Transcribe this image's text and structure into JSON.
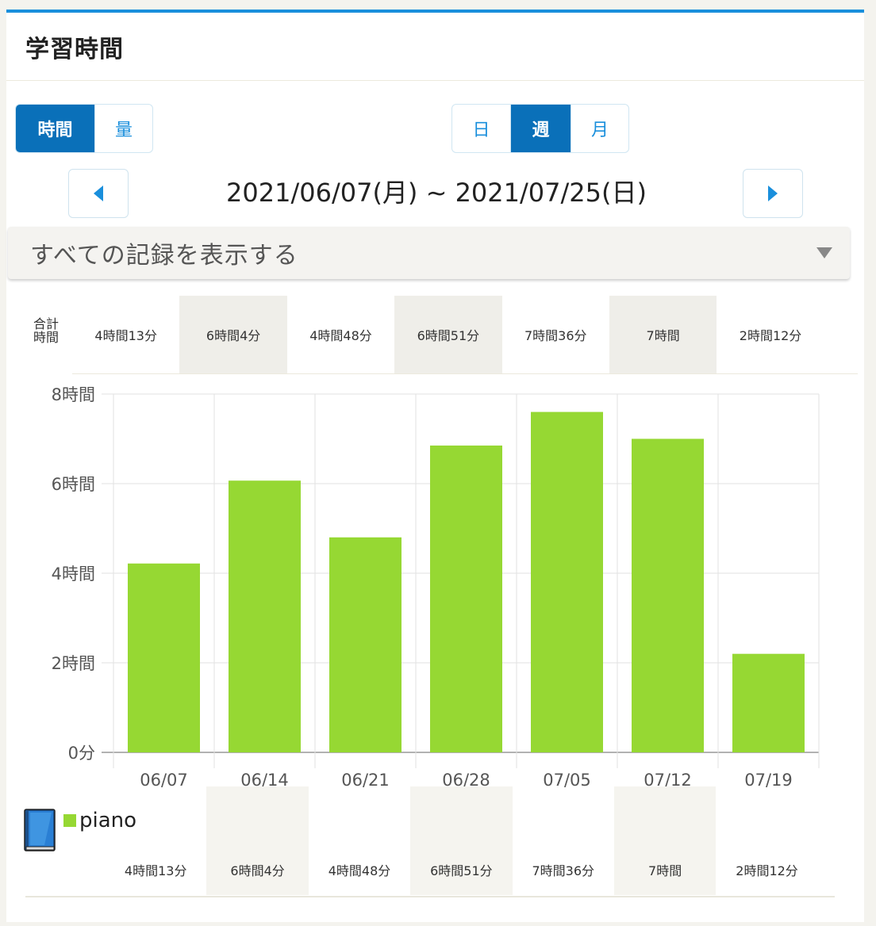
{
  "header": {
    "title": "学習時間"
  },
  "metric_toggle": {
    "options": [
      "時間",
      "量"
    ],
    "active": 0
  },
  "period_toggle": {
    "options": [
      "日",
      "週",
      "月"
    ],
    "active": 1
  },
  "date_range": "2021/06/07(月) ~ 2021/07/25(日)",
  "filter": {
    "label": "すべての記録を表示する"
  },
  "totals": {
    "label": "合計時間",
    "values": [
      "4時間13分",
      "6時間4分",
      "4時間48分",
      "6時間51分",
      "7時間36分",
      "7時間",
      "2時間12分"
    ]
  },
  "legend": {
    "name": "piano",
    "color": "#96d833"
  },
  "book_totals": [
    "4時間13分",
    "6時間4分",
    "4時間48分",
    "6時間51分",
    "7時間36分",
    "7時間",
    "2時間12分"
  ],
  "chart_data": {
    "type": "bar",
    "categories": [
      "06/07",
      "06/14",
      "06/21",
      "06/28",
      "07/05",
      "07/12",
      "07/19"
    ],
    "series": [
      {
        "name": "piano",
        "color": "#96d833",
        "values": [
          253,
          364,
          288,
          411,
          456,
          420,
          132
        ]
      }
    ],
    "ylim": [
      0,
      480
    ],
    "yticks": [
      {
        "value": 0,
        "label": "0分"
      },
      {
        "value": 120,
        "label": "2時間"
      },
      {
        "value": 240,
        "label": "4時間"
      },
      {
        "value": 360,
        "label": "6時間"
      },
      {
        "value": 480,
        "label": "8時間"
      }
    ],
    "grid": true
  }
}
